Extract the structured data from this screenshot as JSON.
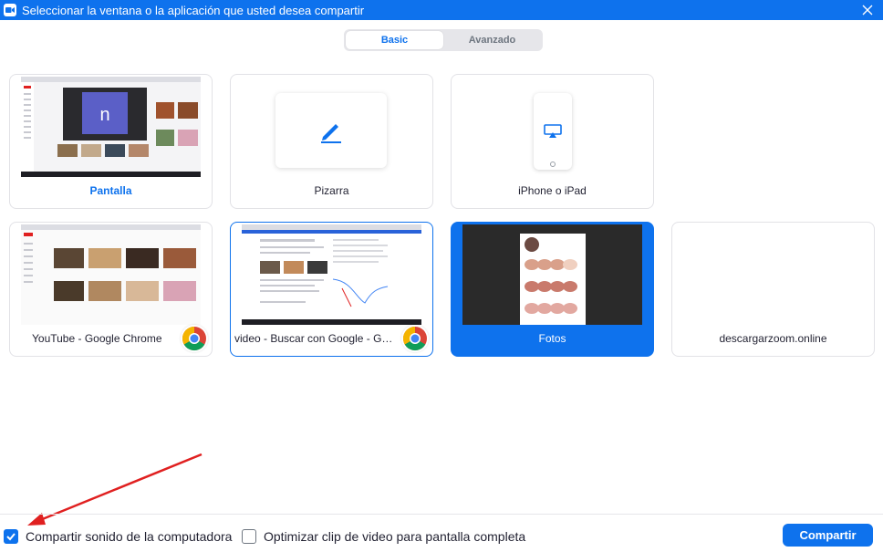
{
  "window": {
    "title": "Seleccionar la ventana o la aplicación que usted desea compartir"
  },
  "tabs": [
    {
      "label": "Basic",
      "active": true
    },
    {
      "label": "Avanzado",
      "active": false
    }
  ],
  "tiles": {
    "pantalla": {
      "label": "Pantalla",
      "thumb_letter": "n"
    },
    "pizarra": {
      "label": "Pizarra"
    },
    "iphone": {
      "label": "iPhone o iPad"
    },
    "youtube": {
      "label": "YouTube - Google Chrome"
    },
    "video": {
      "label": "video - Buscar con Google - Goo..."
    },
    "fotos": {
      "label": "Fotos"
    },
    "descargar": {
      "label": "descargarzoom.online"
    }
  },
  "footer": {
    "share_sound": {
      "label": "Compartir sonido de la computadora",
      "checked": true
    },
    "optimize_clip": {
      "label": "Optimizar clip de video para pantalla completa",
      "checked": false
    },
    "share_button": "Compartir"
  },
  "colors": {
    "accent": "#0e72ed",
    "annotation_arrow": "#e02020"
  }
}
